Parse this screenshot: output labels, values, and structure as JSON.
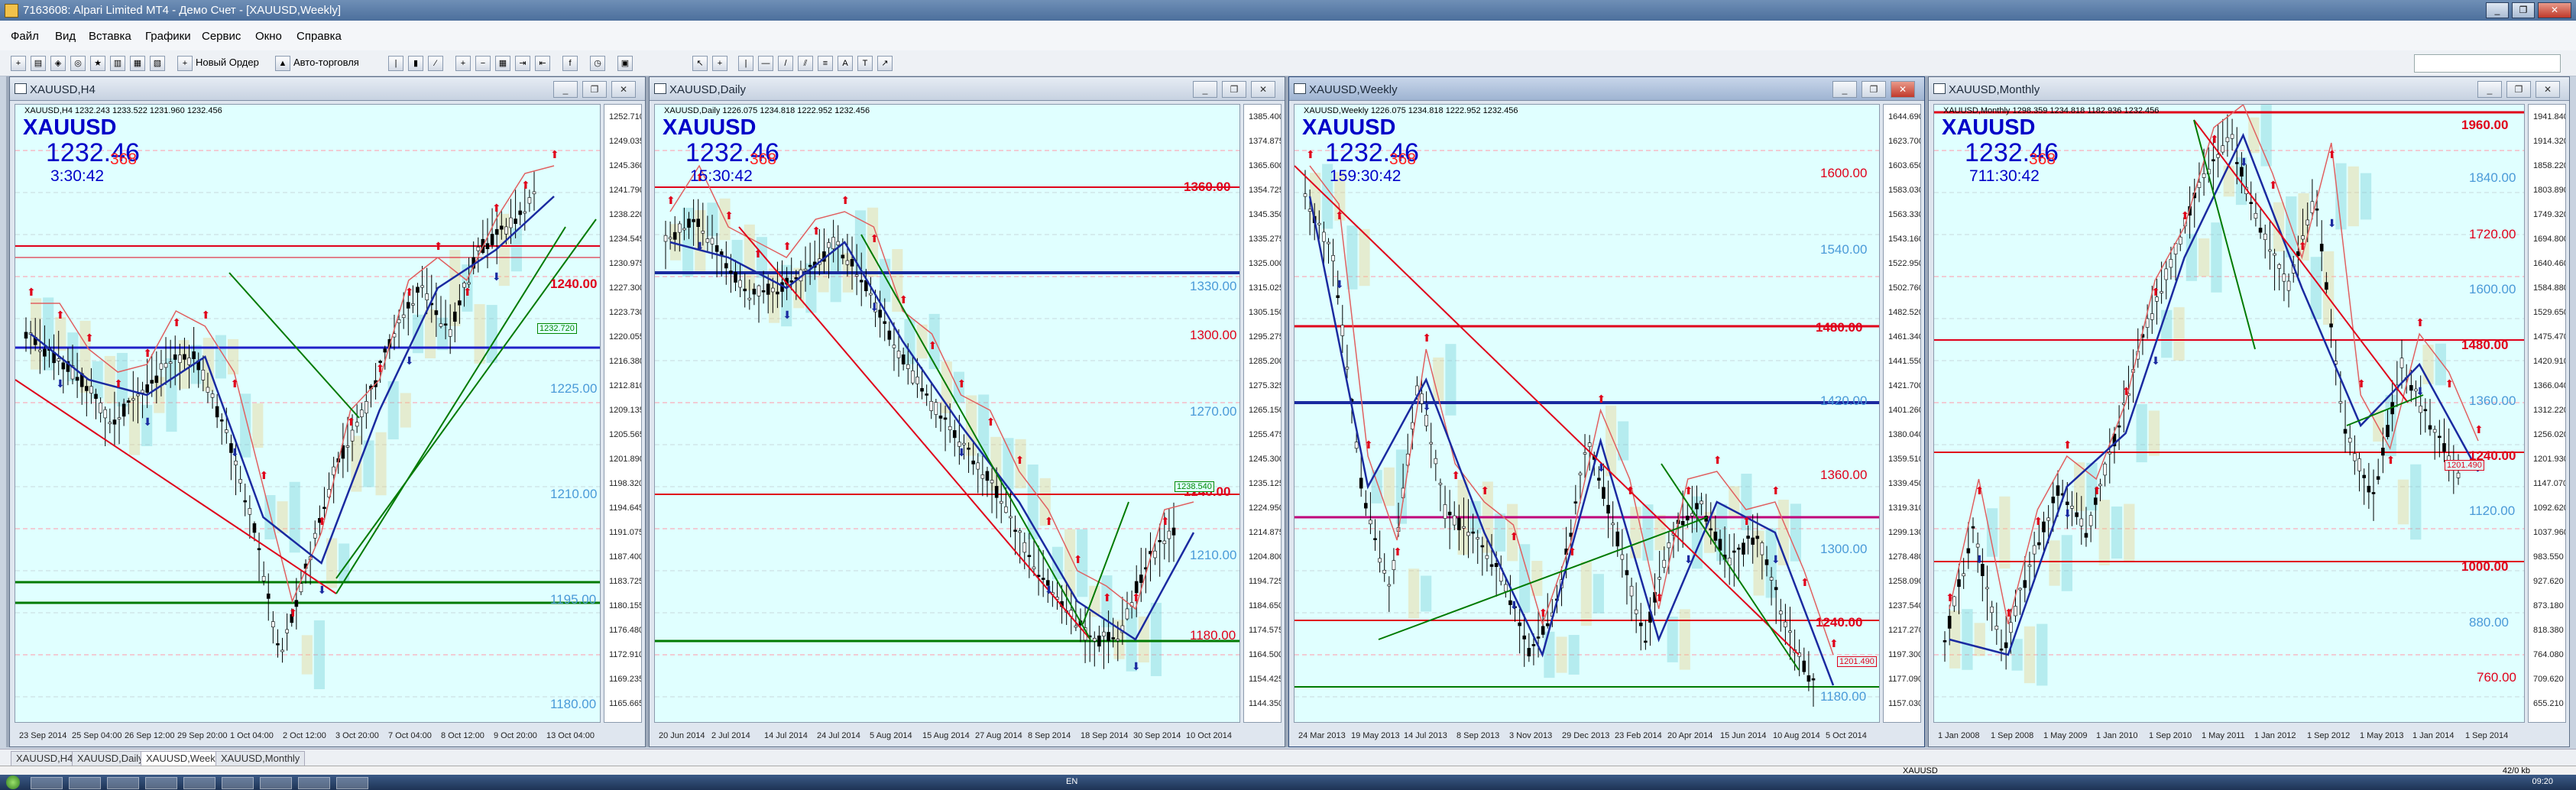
{
  "app": {
    "title": "7163608: Alpari Limited MT4 - Демо Счет - [XAUUSD,Weekly]",
    "menu": [
      "Файл",
      "Вид",
      "Вставка",
      "Графики",
      "Сервис",
      "Окно",
      "Справка"
    ],
    "toolbar": {
      "new_order": "Новый Ордер",
      "autotrade": "Авто-торговля"
    },
    "window_buttons": [
      "_",
      "❐",
      "✕"
    ]
  },
  "tabs": [
    "XAUUSD,H4",
    "XAUUSD,Daily",
    "XAUUSD,Weekly",
    "XAUUSD,Monthly"
  ],
  "status": {
    "symbol": "XAUUSD",
    "traffic": "42/0 kb"
  },
  "taskbar": {
    "lang": "EN",
    "time": "09:20"
  },
  "colors": {
    "plot_bg": "#e0ffff",
    "red_line": "#e0001a",
    "blue_line": "#0000c8",
    "green_line": "#007a00",
    "cyan_level": "#4a9ad8"
  },
  "charts": [
    {
      "title": "XAUUSD,H4",
      "ohlc": "XAUUSD,H4  1232.243 1233.522 1231.960 1232.456",
      "symbol": "XAUUSD",
      "price": "1232.46",
      "timer": "3:30:42",
      "spread": "368",
      "axis": [
        "1252.710",
        "1249.035",
        "1245.360",
        "1241.790",
        "1238.220",
        "1234.545",
        "1230.975",
        "1227.300",
        "1223.730",
        "1220.055",
        "1216.380",
        "1212.810",
        "1209.135",
        "1205.565",
        "1201.890",
        "1198.320",
        "1194.645",
        "1191.075",
        "1187.400",
        "1183.725",
        "1180.155",
        "1176.480",
        "1172.910",
        "1169.235",
        "1165.665"
      ],
      "dates": [
        "23 Sep 2014",
        "25 Sep 04:00",
        "26 Sep 12:00",
        "29 Sep 20:00",
        "1 Oct 04:00",
        "2 Oct 12:00",
        "3 Oct 20:00",
        "7 Oct 04:00",
        "8 Oct 12:00",
        "9 Oct 20:00",
        "13 Oct 04:00"
      ],
      "levels_bold": [
        "1240.00"
      ],
      "levels_cyan": [
        "1225.00",
        "1210.00",
        "1195.00",
        "1180.00"
      ],
      "box_label": "1232.720"
    },
    {
      "title": "XAUUSD,Daily",
      "ohlc": "XAUUSD,Daily  1226.075 1234.818 1222.952 1232.456",
      "symbol": "XAUUSD",
      "price": "1232.46",
      "timer": "15:30:42",
      "spread": "368",
      "axis": [
        "1385.400",
        "1374.875",
        "1365.600",
        "1354.725",
        "1345.350",
        "1335.275",
        "1325.000",
        "1315.025",
        "1305.150",
        "1295.275",
        "1285.200",
        "1275.325",
        "1265.150",
        "1255.475",
        "1245.300",
        "1235.125",
        "1224.950",
        "1214.875",
        "1204.800",
        "1194.725",
        "1184.650",
        "1174.575",
        "1164.500",
        "1154.425",
        "1144.350"
      ],
      "dates": [
        "20 Jun 2014",
        "2 Jul 2014",
        "14 Jul 2014",
        "24 Jul 2014",
        "5 Aug 2014",
        "15 Aug 2014",
        "27 Aug 2014",
        "8 Sep 2014",
        "18 Sep 2014",
        "30 Sep 2014",
        "10 Oct 2014"
      ],
      "levels_bold": [
        "1360.00",
        "1240.00"
      ],
      "levels_cyan": [
        "1330.00",
        "1270.00",
        "1210.00"
      ],
      "levels_red": [
        "1300.00",
        "1180.00"
      ],
      "box_label": "1238.540"
    },
    {
      "title": "XAUUSD,Weekly",
      "ohlc": "XAUUSD,Weekly  1226.075 1234.818 1222.952 1232.456",
      "symbol": "XAUUSD",
      "price": "1232.46",
      "timer": "159:30:42",
      "spread": "368",
      "axis": [
        "1644.690",
        "1623.700",
        "1603.650",
        "1583.030",
        "1563.330",
        "1543.160",
        "1522.950",
        "1502.760",
        "1482.520",
        "1461.340",
        "1441.550",
        "1421.700",
        "1401.260",
        "1380.040",
        "1359.510",
        "1339.450",
        "1319.310",
        "1299.130",
        "1278.480",
        "1258.090",
        "1237.540",
        "1217.270",
        "1197.300",
        "1177.090",
        "1157.030"
      ],
      "dates": [
        "24 Mar 2013",
        "19 May 2013",
        "14 Jul 2013",
        "8 Sep 2013",
        "3 Nov 2013",
        "29 Dec 2013",
        "23 Feb 2014",
        "20 Apr 2014",
        "15 Jun 2014",
        "10 Aug 2014",
        "5 Oct 2014"
      ],
      "levels_bold": [
        "1480.00",
        "1240.00"
      ],
      "levels_cyan": [
        "1540.00",
        "1420.00",
        "1300.00",
        "1180.00"
      ],
      "levels_red": [
        "1600.00",
        "1360.00"
      ],
      "box_label": "1201.490"
    },
    {
      "title": "XAUUSD,Monthly",
      "ohlc": "XAUUSD,Monthly  1298.359 1234.818 1182.936 1232.456",
      "symbol": "XAUUSD",
      "price": "1232.46",
      "timer": "711:30:42",
      "spread": "368",
      "axis": [
        "1941.840",
        "1914.320",
        "1858.220",
        "1803.890",
        "1749.320",
        "1694.800",
        "1640.460",
        "1584.880",
        "1529.650",
        "1475.470",
        "1420.910",
        "1366.040",
        "1312.220",
        "1256.020",
        "1201.930",
        "1147.070",
        "1092.620",
        "1037.960",
        "983.550",
        "927.620",
        "873.180",
        "818.380",
        "764.080",
        "709.620",
        "655.210"
      ],
      "dates": [
        "1 Jan 2008",
        "1 Sep 2008",
        "1 May 2009",
        "1 Jan 2010",
        "1 Sep 2010",
        "1 May 2011",
        "1 Jan 2012",
        "1 Sep 2012",
        "1 May 2013",
        "1 Jan 2014",
        "1 Sep 2014"
      ],
      "levels_bold": [
        "1960.00",
        "1480.00",
        "1240.00",
        "1000.00"
      ],
      "levels_cyan": [
        "1840.00",
        "1600.00",
        "1360.00",
        "1120.00",
        "880.00"
      ],
      "levels_red": [
        "1720.00",
        "760.00"
      ],
      "box_label": "1201.490"
    }
  ]
}
